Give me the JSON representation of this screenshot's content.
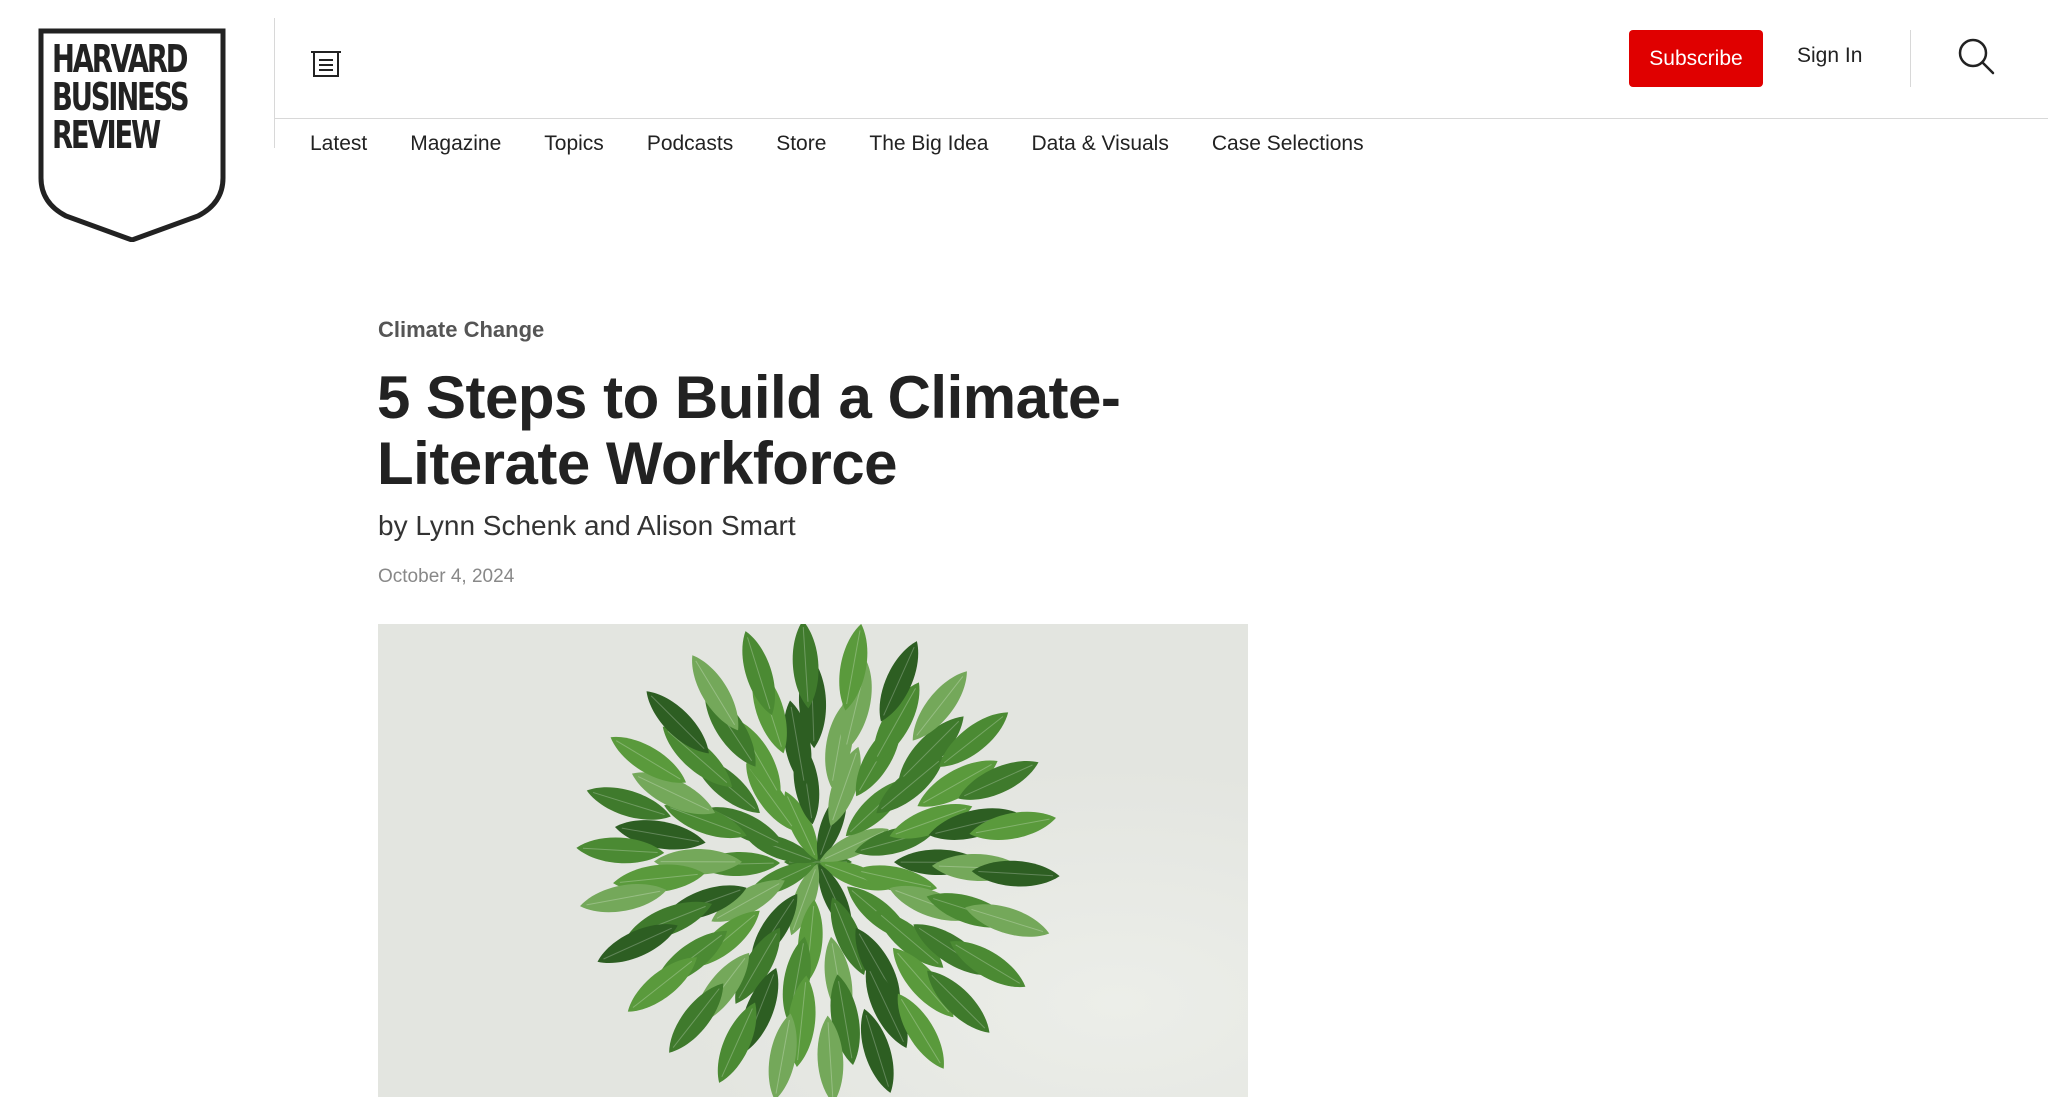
{
  "brand": {
    "logo_lines": [
      "HARVARD",
      "BUSINESS",
      "REVIEW"
    ]
  },
  "header": {
    "menu_icon": "menu-icon",
    "subscribe_label": "Subscribe",
    "sign_in_label": "Sign In",
    "search_icon": "search-icon",
    "accent_color": "#e00000"
  },
  "nav": {
    "items": [
      "Latest",
      "Magazine",
      "Topics",
      "Podcasts",
      "Store",
      "The Big Idea",
      "Data & Visuals",
      "Case Selections"
    ]
  },
  "article": {
    "topic": "Climate Change",
    "title": "5 Steps to Build a Climate-Literate Workforce",
    "byline": "by Lynn Schenk and Alison Smart",
    "date": "October 4, 2024"
  },
  "hero": {
    "background_color": "#e3e5e0",
    "leaf_colors": [
      "#3f7a2c",
      "#5a9a3c",
      "#2d5e22",
      "#74a85a",
      "#4b8a33"
    ]
  }
}
